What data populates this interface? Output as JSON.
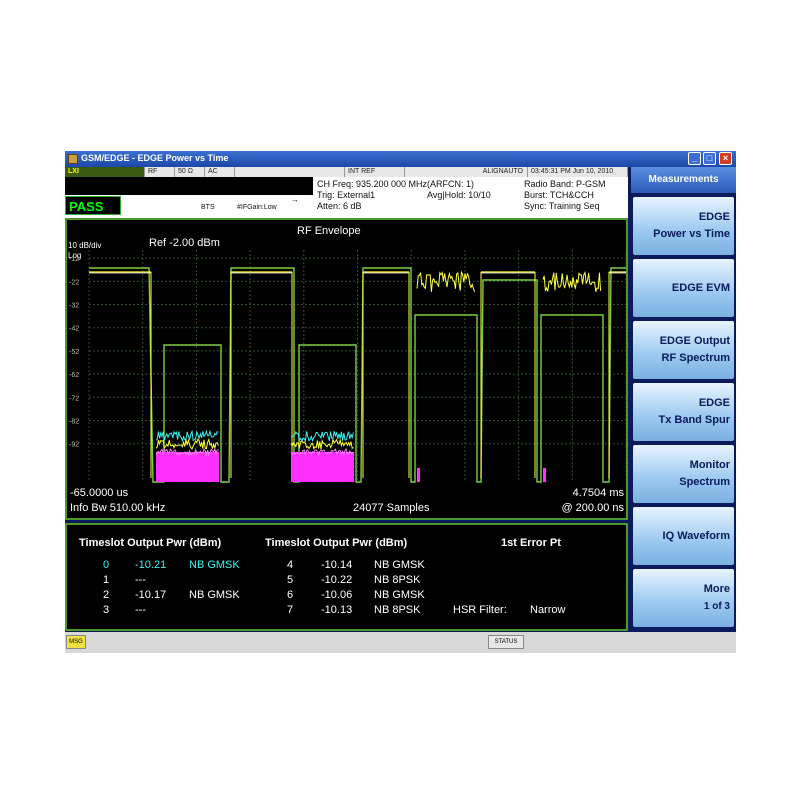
{
  "window": {
    "title": "GSM/EDGE - EDGE Power vs Time"
  },
  "status_row": {
    "logo": "LXI",
    "rf": "RF",
    "impedance": "50 Ω",
    "coupling": "AC",
    "ref": "INT REF",
    "align": "ALIGNAUTO",
    "datetime": "03:45:31 PM Jun 10, 2010"
  },
  "header": {
    "pass": "PASS",
    "device": "BTS",
    "if_gain": "#IFGain:Low",
    "ch_freq": "CH Freq: 935.200 000 MHz(ARFCN: 1)",
    "trig": "Trig: External1",
    "atten": "Atten: 6 dB",
    "avg_hold": "Avg|Hold: 10/10",
    "radio_band": "Radio Band: P-GSM",
    "burst": "Burst: TCH&CCH",
    "sync": "Sync: Training Seq"
  },
  "plot": {
    "title": "RF Envelope",
    "scale": "10 dB/div",
    "log": "Log",
    "ref": "Ref  -2.00 dBm",
    "y_ticks": [
      "-12",
      "-22",
      "-32",
      "-42",
      "-52",
      "-62",
      "-72",
      "-82",
      "-92"
    ],
    "start": "-65.0000 us",
    "stop": "4.7504 ms",
    "info_bw": "Info Bw 510.00 kHz",
    "samples": "24077 Samples",
    "resolution": "@ 200.00 ns",
    "colors": {
      "trace_yellow": "#ffff40",
      "trace_cyan": "#40f0f0",
      "trace_magenta": "#ff30ff",
      "mask_green": "#7ad040",
      "mean_white": "#ffffff"
    }
  },
  "table": {
    "col1_header": "Timeslot Output Pwr (dBm)",
    "col2_header": "Timeslot Output Pwr (dBm)",
    "col3_header": "1st Error Pt",
    "left_rows": [
      {
        "slot": "0",
        "pwr": "-10.21",
        "mod": "NB GMSK",
        "highlight": true
      },
      {
        "slot": "1",
        "pwr": "---",
        "mod": "",
        "highlight": false
      },
      {
        "slot": "2",
        "pwr": "-10.17",
        "mod": "NB GMSK",
        "highlight": false
      },
      {
        "slot": "3",
        "pwr": "---",
        "mod": "",
        "highlight": false
      }
    ],
    "right_rows": [
      {
        "slot": "4",
        "pwr": "-10.14",
        "mod": "NB GMSK"
      },
      {
        "slot": "5",
        "pwr": "-10.22",
        "mod": "NB 8PSK"
      },
      {
        "slot": "6",
        "pwr": "-10.06",
        "mod": "NB GMSK"
      },
      {
        "slot": "7",
        "pwr": "-10.13",
        "mod": "NB 8PSK"
      }
    ],
    "hsr_label": "HSR Filter:",
    "hsr_value": "Narrow"
  },
  "bottom": {
    "msg": "MSG",
    "status": "STATUS"
  },
  "menu": {
    "title": "Measurements",
    "keys": [
      {
        "line1": "EDGE",
        "line2": "Power vs Time"
      },
      {
        "line1": "EDGE EVM",
        "line2": ""
      },
      {
        "line1": "EDGE Output",
        "line2": "RF Spectrum"
      },
      {
        "line1": "EDGE",
        "line2": "Tx Band Spur"
      },
      {
        "line1": "Monitor",
        "line2": "Spectrum"
      },
      {
        "line1": "IQ Waveform",
        "line2": ""
      },
      {
        "line1": "More",
        "line2": "1 of 3"
      }
    ]
  }
}
